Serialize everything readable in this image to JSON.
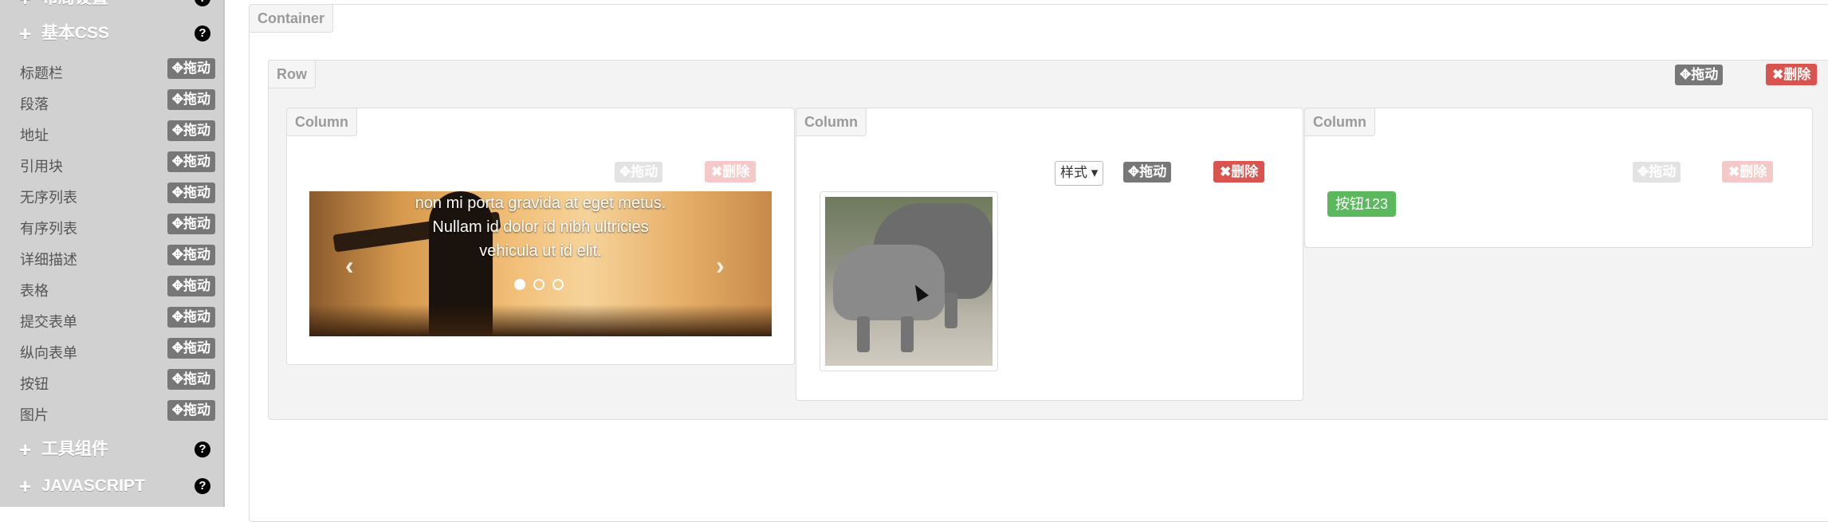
{
  "sidebar": {
    "sections": [
      {
        "label": "布局设置"
      },
      {
        "label": "基本CSS"
      },
      {
        "label": "工具组件"
      },
      {
        "label": "JAVASCRIPT"
      }
    ],
    "help_glyph": "?",
    "drag_label": "✥拖动",
    "items": [
      {
        "label": "标题栏"
      },
      {
        "label": "段落"
      },
      {
        "label": "地址"
      },
      {
        "label": "引用块"
      },
      {
        "label": "无序列表"
      },
      {
        "label": "有序列表"
      },
      {
        "label": "详细描述"
      },
      {
        "label": "表格"
      },
      {
        "label": "提交表单"
      },
      {
        "label": "纵向表单"
      },
      {
        "label": "按钮"
      },
      {
        "label": "图片"
      }
    ]
  },
  "canvas": {
    "container_label": "Container",
    "row_label": "Row",
    "column_label": "Column",
    "drag_label": "✥拖动",
    "delete_label": "✖删除",
    "style_label": "样式 ▾",
    "carousel": {
      "caption_lines": [
        "non mi porta gravida at eget metus.",
        "Nullam id dolor id nibh ultricies",
        "vehicula ut id elit."
      ],
      "prev_icon": "‹",
      "next_icon": "›",
      "active_slide": 1,
      "slide_count": 3
    },
    "green_button_label": "按钮123"
  },
  "colors": {
    "sidebar_bg": "#d1d1d1",
    "drag_btn": "#777777",
    "delete_btn": "#d9534f",
    "success_btn": "#5cb85c"
  }
}
